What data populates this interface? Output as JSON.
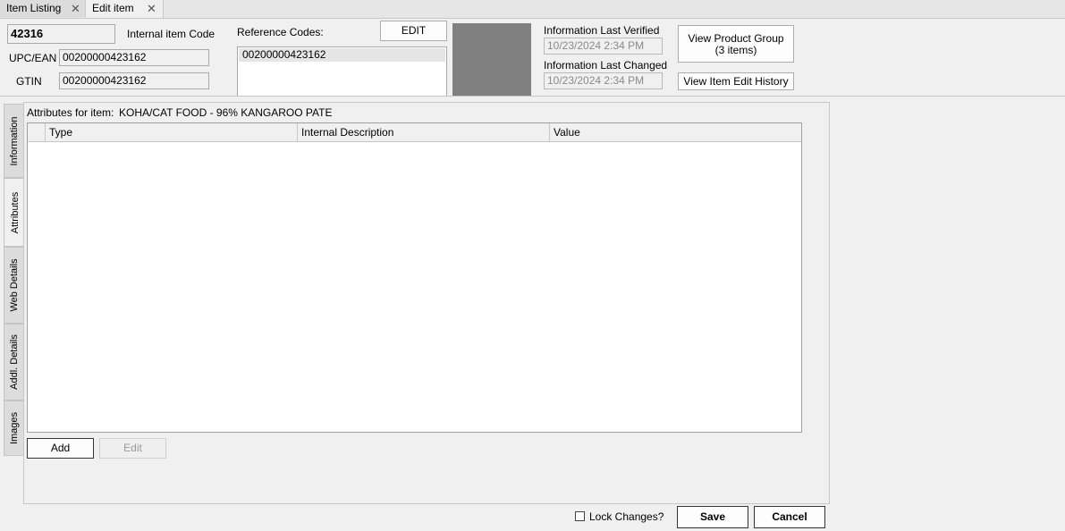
{
  "tabs": [
    {
      "label": "Item Listing",
      "active": false
    },
    {
      "label": "Edit item",
      "active": true
    }
  ],
  "tab_close_glyph": "✕",
  "item": {
    "code": "42316",
    "internal_code_label": "Internal item Code",
    "upc_label": "UPC/EAN",
    "upc_value": "00200000423162",
    "gtin_label": "GTIN",
    "gtin_value": "00200000423162"
  },
  "reference": {
    "label": "Reference Codes:",
    "edit_label": "EDIT",
    "codes": [
      "00200000423162"
    ]
  },
  "info": {
    "verified_label": "Information Last Verified",
    "verified_value": "10/23/2024 2:34 PM",
    "changed_label": "Information Last Changed",
    "changed_value": "10/23/2024 2:34 PM"
  },
  "buttons": {
    "view_group_line1": "View Product Group",
    "view_group_line2": "(3 items)",
    "view_history": "View Item Edit History",
    "add": "Add",
    "edit": "Edit",
    "save": "Save",
    "cancel": "Cancel"
  },
  "side_tabs": [
    "Information",
    "Attributes",
    "Web Details",
    "Addl. Details",
    "Images"
  ],
  "active_side_tab": "Attributes",
  "attributes": {
    "label": "Attributes for item:",
    "item_name": "KOHA/CAT FOOD - 96% KANGAROO PATE",
    "columns": [
      "Type",
      "Internal Description",
      "Value"
    ]
  },
  "lock_changes_label": "Lock Changes?",
  "colors": {
    "image_placeholder": "#808080"
  }
}
